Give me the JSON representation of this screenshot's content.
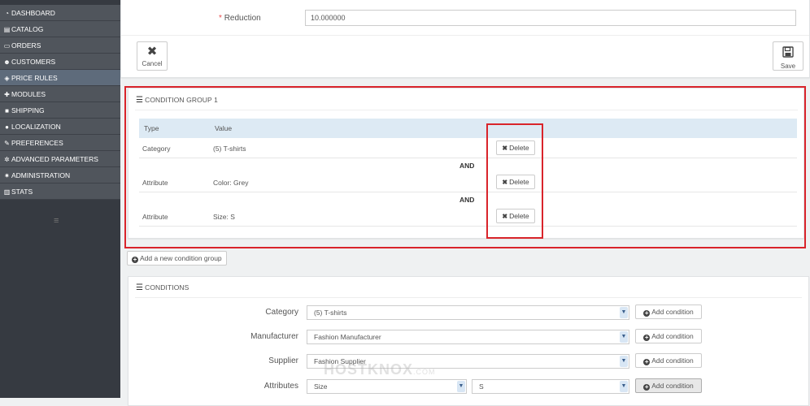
{
  "sidebar": {
    "items": [
      {
        "label": "DASHBOARD",
        "icon": "dashboard-icon",
        "active": false
      },
      {
        "label": "CATALOG",
        "icon": "book-icon",
        "active": false
      },
      {
        "label": "ORDERS",
        "icon": "credit-card-icon",
        "active": false
      },
      {
        "label": "CUSTOMERS",
        "icon": "users-icon",
        "active": false
      },
      {
        "label": "PRICE RULES",
        "icon": "tags-icon",
        "active": true
      },
      {
        "label": "MODULES",
        "icon": "puzzle-icon",
        "active": false
      },
      {
        "label": "SHIPPING",
        "icon": "truck-icon",
        "active": false
      },
      {
        "label": "LOCALIZATION",
        "icon": "globe-icon",
        "active": false
      },
      {
        "label": "PREFERENCES",
        "icon": "wrench-icon",
        "active": false
      },
      {
        "label": "ADVANCED PARAMETERS",
        "icon": "cogs-icon",
        "active": false
      },
      {
        "label": "ADMINISTRATION",
        "icon": "gear-icon",
        "active": false
      },
      {
        "label": "STATS",
        "icon": "bar-chart-icon",
        "active": false
      }
    ]
  },
  "form": {
    "reduction_label": "Reduction",
    "reduction_value": "10.000000",
    "cancel_label": "Cancel",
    "save_label": "Save"
  },
  "condition_group": {
    "title": "CONDITION GROUP 1",
    "columns": {
      "type": "Type",
      "value": "Value"
    },
    "rows": [
      {
        "type": "Category",
        "value": "(5) T-shirts"
      },
      {
        "type": "Attribute",
        "value": "Color: Grey"
      },
      {
        "type": "Attribute",
        "value": "Size: S"
      }
    ],
    "and_label": "AND",
    "delete_label": "Delete"
  },
  "add_group_label": "Add a new condition group",
  "conditions": {
    "title": "CONDITIONS",
    "add_condition_label": "Add condition",
    "fields": [
      {
        "label": "Category",
        "value": "(5) T-shirts"
      },
      {
        "label": "Manufacturer",
        "value": "Fashion Manufacturer"
      },
      {
        "label": "Supplier",
        "value": "Fashion Supplier"
      },
      {
        "label": "Attributes",
        "value": "Size",
        "value2": "S"
      }
    ]
  },
  "watermark": {
    "brand": "HOSTKNOX",
    "suffix": ".COM"
  },
  "colors": {
    "sidebar_bg": "#363a41",
    "highlight_red": "#d9242b",
    "accent_green": "#7cc14d",
    "table_head": "#ddeaf4"
  }
}
